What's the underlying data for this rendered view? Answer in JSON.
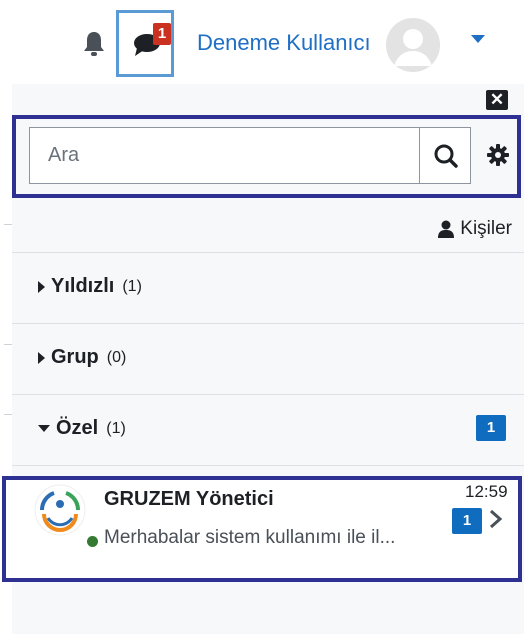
{
  "navbar": {
    "notification_icon": "bell-icon",
    "messages_icon": "chat-icon",
    "messages_badge": "1",
    "user_name": "Deneme Kullanıcı",
    "user_menu_icon": "caret-down-icon"
  },
  "drawer": {
    "close_icon": "close-icon",
    "close_label": "✕",
    "search": {
      "placeholder": "Ara",
      "value": "",
      "button_icon": "search-icon"
    },
    "settings_icon": "gear-icon",
    "contacts_label": "Kişiler",
    "sections": [
      {
        "title": "Yıldızlı",
        "count": "(1)",
        "expanded": false,
        "badge": ""
      },
      {
        "title": "Grup",
        "count": "(0)",
        "expanded": false,
        "badge": ""
      },
      {
        "title": "Özel",
        "count": "(1)",
        "expanded": true,
        "badge": "1"
      }
    ],
    "conversation": {
      "name": "GRUZEM Yönetici",
      "time": "12:59",
      "preview": "Merhabalar sistem kullanımı ile il...",
      "unread": "1",
      "online": true
    }
  },
  "colors": {
    "accent": "#0f6cbf",
    "link": "#1f6fc5",
    "highlight": "#2e3192",
    "badge_red": "#ca3120",
    "online": "#357a32"
  }
}
